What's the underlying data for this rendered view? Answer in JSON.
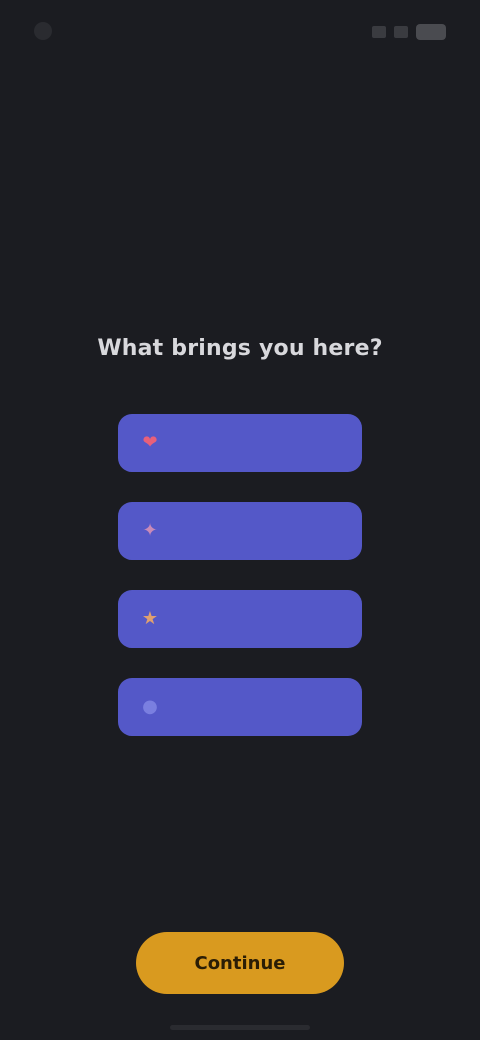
{
  "status_bar": {
    "time": "",
    "icons": [
      "signal-icon",
      "wifi-icon",
      "battery-icon"
    ]
  },
  "title": "What brings you here?",
  "options": [
    {
      "label": "",
      "icon": "heart-icon",
      "emoji": "❤"
    },
    {
      "label": "",
      "icon": "sparkle-icon",
      "emoji": "✦"
    },
    {
      "label": "",
      "icon": "star-icon",
      "emoji": "★"
    },
    {
      "label": "",
      "icon": "circle-icon",
      "emoji": "●"
    }
  ],
  "continue_button": {
    "label": "Continue"
  },
  "colors": {
    "background": "#1b1c21",
    "option": "#5458c8",
    "accent": "#d99a1f"
  }
}
